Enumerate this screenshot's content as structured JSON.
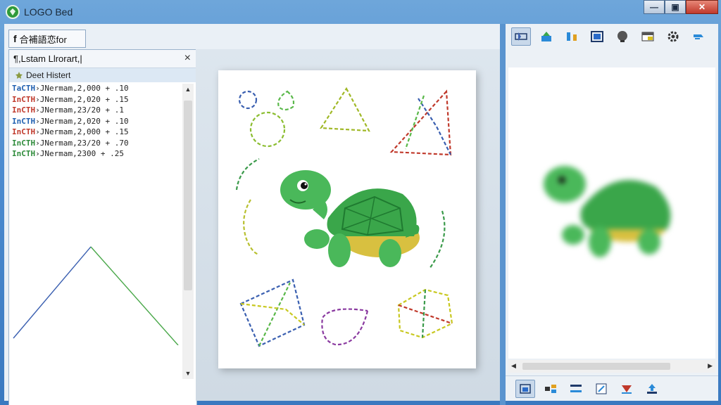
{
  "window": {
    "title": "LOGO Bed",
    "controls": {
      "minimize": "—",
      "maximize": "▣",
      "close": "✕"
    }
  },
  "doc_tab": {
    "icon_label": "f",
    "label": "合補語恋for"
  },
  "layers_panel": {
    "title": "¶,Lstam Llrorart,|",
    "close": "×",
    "subtitle": "Deet Histert",
    "rows": [
      {
        "prefix": "TaCTH",
        "rest": "›JNermam,2,000  + .10",
        "color": "#1f5fb0"
      },
      {
        "prefix": "InCTH",
        "rest": "›JNermam,2,020  + .15",
        "color": "#c0392b"
      },
      {
        "prefix": "InCTH",
        "rest": "›JNermam,23/20  + .1",
        "color": "#c0392b"
      },
      {
        "prefix": "InCTH",
        "rest": "›JNermam,2,020  + .10",
        "color": "#1f5fb0"
      },
      {
        "prefix": "InCTH",
        "rest": "›JNermam,2,000  + .15",
        "color": "#c0392b"
      },
      {
        "prefix": "InCTH",
        "rest": "›JNermam,23/20  + .70",
        "color": "#2e8b3a"
      },
      {
        "prefix": "InCTH",
        "rest": "›JNermam,2300  + .25",
        "color": "#2e8b3a"
      }
    ]
  },
  "scroll_glyphs": {
    "up": "▲",
    "down": "▼",
    "left": "◀",
    "right": "▶"
  },
  "icons": {
    "app_logo": "turtle-logo-icon",
    "turtle": "turtle-illustration",
    "top_toolbar": [
      "select-tool-icon",
      "export-icon",
      "align-icon",
      "frame-icon",
      "stamp-icon",
      "table-icon",
      "settings-gear-icon",
      "pen-icon"
    ],
    "bottom_toolbar": [
      "layers-icon",
      "arrange-icon",
      "menu-icon",
      "edit-icon",
      "marker-icon",
      "upload-icon"
    ]
  },
  "colors": {
    "turtle_green": "#3aa64a",
    "shell_dark": "#2a8a3c",
    "stroke_blue": "#3a5fb0",
    "stroke_green": "#5ab84a",
    "stroke_yellow": "#c8c820",
    "stroke_red": "#c0392b"
  }
}
